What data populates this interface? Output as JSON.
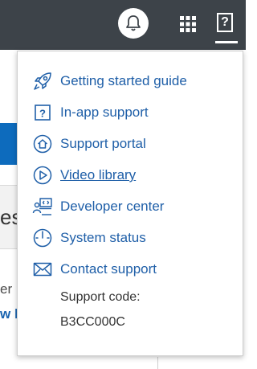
{
  "header": {
    "notifications_icon": "bell-icon",
    "apps_icon": "grid-icon",
    "help_label": "?"
  },
  "menu": {
    "items": [
      {
        "label": "Getting started guide",
        "icon": "rocket-icon"
      },
      {
        "label": "In-app support",
        "icon": "question-box-icon"
      },
      {
        "label": "Support portal",
        "icon": "home-circle-icon"
      },
      {
        "label": "Video library",
        "icon": "play-circle-icon"
      },
      {
        "label": "Developer center",
        "icon": "developer-icon"
      },
      {
        "label": "System status",
        "icon": "gauge-icon"
      },
      {
        "label": "Contact support",
        "icon": "envelope-icon"
      }
    ],
    "support_code_label": "Support code:",
    "support_code_value": "B3CC000C"
  },
  "background": {
    "card_text": "es",
    "text_line1": "er p",
    "text_line2": "w l"
  },
  "colors": {
    "topbar": "#3d4349",
    "link": "#1f5fa8",
    "accent": "#0d6bbd"
  }
}
